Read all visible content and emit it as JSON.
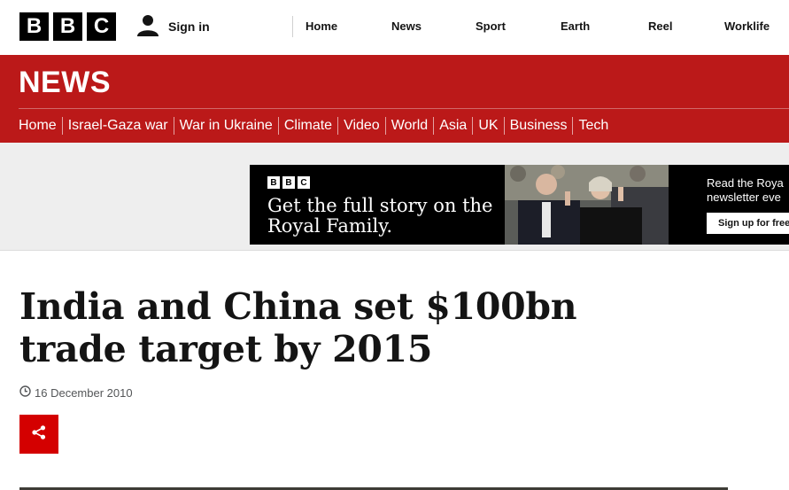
{
  "brand": {
    "letters": [
      "B",
      "B",
      "C"
    ]
  },
  "header": {
    "signin_label": "Sign in",
    "nav": [
      "Home",
      "News",
      "Sport",
      "Earth",
      "Reel",
      "Worklife"
    ]
  },
  "news": {
    "title": "NEWS",
    "subnav": [
      "Home",
      "Israel-Gaza war",
      "War in Ukraine",
      "Climate",
      "Video",
      "World",
      "Asia",
      "UK",
      "Business",
      "Tech"
    ]
  },
  "ad": {
    "logo_letters": [
      "B",
      "B",
      "C"
    ],
    "headline": "Get the full story on the Royal Family.",
    "side_text_line1": "Read the Roya",
    "side_text_line2": "newsletter eve",
    "cta": "Sign up for free"
  },
  "article": {
    "headline": "India and China set $100bn trade target by 2015",
    "date": "16 December 2010"
  },
  "colors": {
    "brand_red": "#bb1919",
    "share_red": "#d40000",
    "text": "#141414"
  },
  "icons": {
    "signin": "user-icon",
    "date": "clock-icon",
    "share": "share-icon"
  }
}
